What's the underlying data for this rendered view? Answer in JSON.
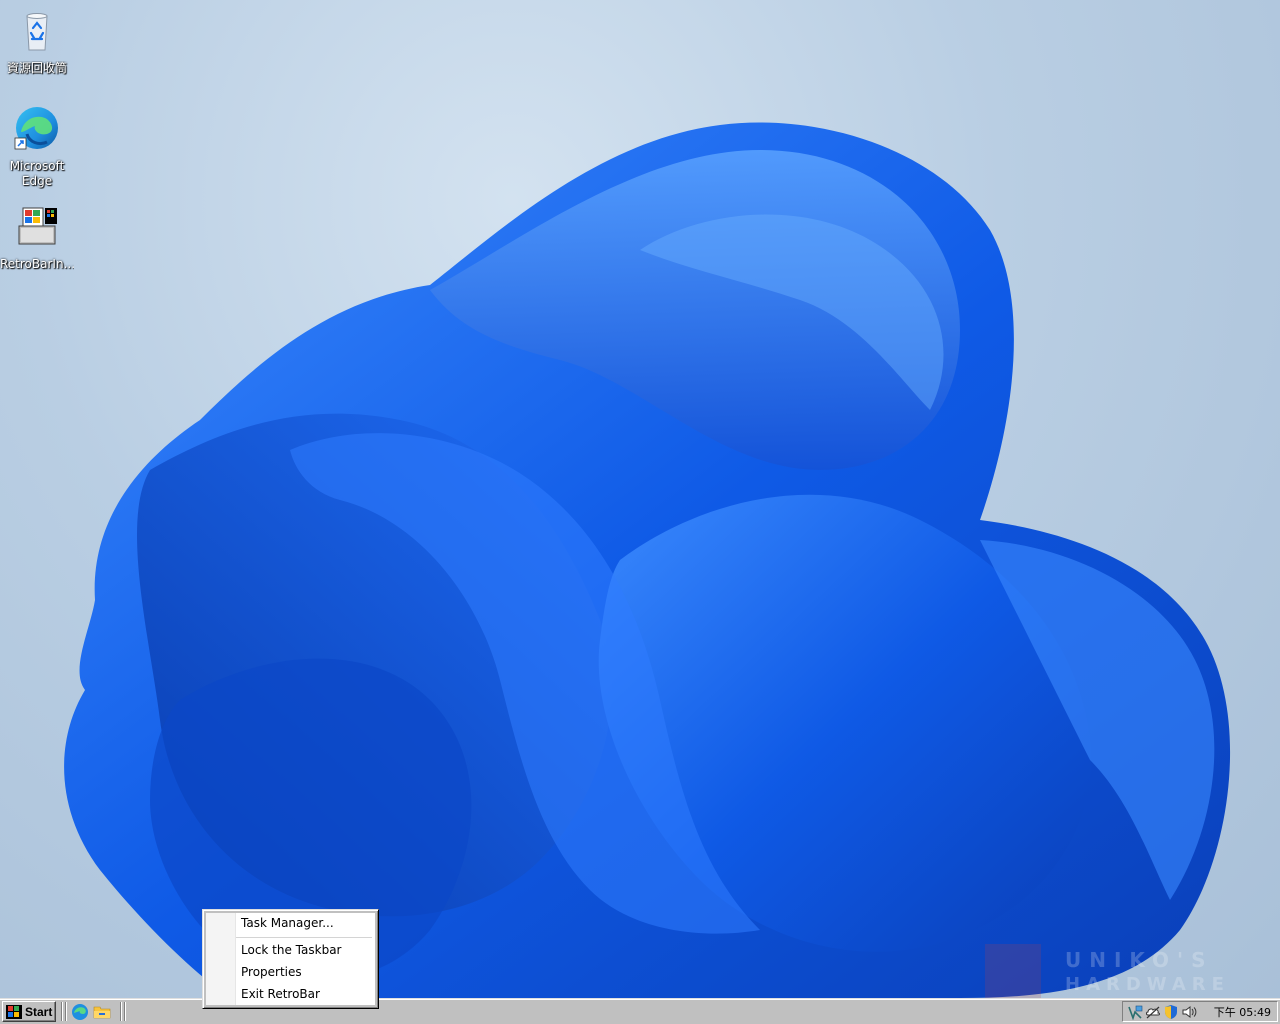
{
  "desktop": {
    "icons": [
      {
        "label": "資源回收筒",
        "icon": "recycle-bin-icon"
      },
      {
        "label": "Microsoft\nEdge",
        "label_line1": "Microsoft",
        "label_line2": "Edge",
        "icon": "edge-icon"
      },
      {
        "label": "RetroBarIn...",
        "icon": "retrobar-installer-icon"
      }
    ]
  },
  "taskbar": {
    "start_label": "Start",
    "quick_launch": [
      {
        "icon": "edge-icon"
      },
      {
        "icon": "file-explorer-icon"
      }
    ],
    "tray": {
      "icons": [
        "network-icon",
        "onedrive-icon",
        "security-shield-icon",
        "volume-icon"
      ],
      "clock": "下午 05:49"
    }
  },
  "context_menu": {
    "items": [
      {
        "label": "Task Manager..."
      },
      {
        "label": "Lock the Taskbar"
      },
      {
        "label": "Properties"
      },
      {
        "label": "Exit RetroBar"
      }
    ]
  },
  "watermark": {
    "line1": "UNIKO'S",
    "line2": "HARDWARE"
  },
  "colors": {
    "taskbar": "#c0c0c0",
    "wallpaper_bg": "#b9cee3",
    "bloom_blue": "#1560e8"
  }
}
